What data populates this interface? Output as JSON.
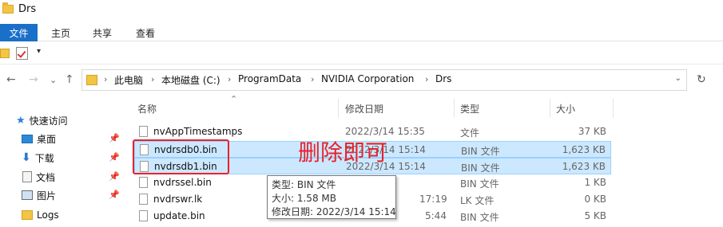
{
  "window": {
    "title": "Drs"
  },
  "ribbon": {
    "tabs": [
      "文件",
      "主页",
      "共享",
      "查看"
    ]
  },
  "qat": {
    "more": "▾"
  },
  "nav": {
    "back": "←",
    "forward": "→",
    "dropdown": "⌄",
    "up": "↑",
    "refresh": "↻"
  },
  "address": {
    "crumbs": [
      "此电脑",
      "本地磁盘 (C:)",
      "ProgramData",
      "NVIDIA Corporation",
      "Drs"
    ],
    "separator": "›",
    "dropdown": "⌄"
  },
  "sidebar": {
    "items": [
      {
        "label": "快速访问",
        "icon": "star-icon"
      },
      {
        "label": "桌面",
        "icon": "desktop-icon",
        "pinned": true
      },
      {
        "label": "下载",
        "icon": "download-icon",
        "pinned": true
      },
      {
        "label": "文档",
        "icon": "document-icon",
        "pinned": true
      },
      {
        "label": "图片",
        "icon": "picture-icon",
        "pinned": true
      },
      {
        "label": "Logs",
        "icon": "folder-icon",
        "pinned": false
      }
    ],
    "pin_glyph": "📌"
  },
  "columns": {
    "name": "名称",
    "date": "修改日期",
    "type": "类型",
    "size": "大小",
    "sort_glyph": "⌃"
  },
  "files": [
    {
      "name": "nvAppTimestamps",
      "date": "2022/3/14 15:35",
      "type": "文件",
      "size": "37 KB",
      "selected": false
    },
    {
      "name": "nvdrsdb0.bin",
      "date": "2022/3/14 15:14",
      "type": "BIN 文件",
      "size": "1,623 KB",
      "selected": true
    },
    {
      "name": "nvdrsdb1.bin",
      "date": "2022/3/14 15:14",
      "type": "BIN 文件",
      "size": "1,623 KB",
      "selected": true
    },
    {
      "name": "nvdrssel.bin",
      "date": "",
      "type": "BIN 文件",
      "size": "1 KB",
      "selected": false
    },
    {
      "name": "nvdrswr.lk",
      "date": "17:19",
      "type": "LK 文件",
      "size": "0 KB",
      "selected": false
    },
    {
      "name": "update.bin",
      "date": "5:44",
      "type": "BIN 文件",
      "size": "5 KB",
      "selected": false
    }
  ],
  "annotation": {
    "text": "删除即可",
    "color": "#e8222c"
  },
  "tooltip": {
    "type_line": "类型: BIN 文件",
    "size_line": "大小: 1.58 MB",
    "date_line": "修改日期: 2022/3/14 15:14"
  },
  "colors": {
    "accent": "#1a6fc9",
    "selection": "#cce8ff",
    "folder": "#f4c542"
  }
}
